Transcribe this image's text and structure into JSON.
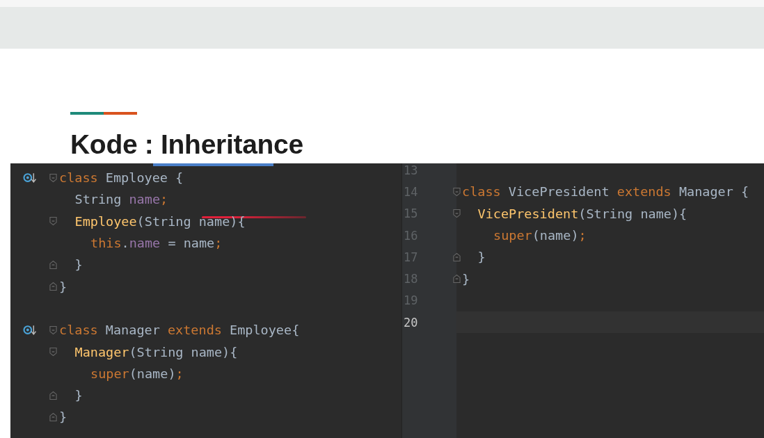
{
  "slide": {
    "title": "Kode : Inheritance"
  },
  "left_editor": {
    "lines": [
      {
        "gutter_icon": true,
        "fold_start": true,
        "fold_end": false,
        "kind": "top",
        "tokens": [
          {
            "kind": "keyword",
            "text": "class "
          },
          {
            "kind": "plain",
            "text": "Employee {"
          }
        ]
      },
      {
        "gutter_icon": false,
        "fold_start": false,
        "fold_end": false,
        "kind": "member",
        "tokens": [
          {
            "kind": "plain",
            "text": "String "
          },
          {
            "kind": "field",
            "text": "name"
          },
          {
            "kind": "keyword",
            "text": ";"
          }
        ]
      },
      {
        "gutter_icon": false,
        "fold_start": true,
        "fold_end": false,
        "kind": "member",
        "tokens": [
          {
            "kind": "method",
            "text": "Employee"
          },
          {
            "kind": "plain",
            "text": "(String name){"
          }
        ]
      },
      {
        "gutter_icon": false,
        "fold_start": false,
        "fold_end": false,
        "kind": "statement",
        "tokens": [
          {
            "kind": "keyword",
            "text": "this"
          },
          {
            "kind": "plain",
            "text": "."
          },
          {
            "kind": "field",
            "text": "name"
          },
          {
            "kind": "plain",
            "text": " = name"
          },
          {
            "kind": "keyword",
            "text": ";"
          }
        ]
      },
      {
        "gutter_icon": false,
        "fold_start": false,
        "fold_end": true,
        "kind": "member",
        "tokens": [
          {
            "kind": "plain",
            "text": "}"
          }
        ]
      },
      {
        "gutter_icon": false,
        "fold_start": false,
        "fold_end": true,
        "kind": "top",
        "tokens": [
          {
            "kind": "plain",
            "text": "}"
          }
        ]
      },
      {
        "gutter_icon": false,
        "fold_start": false,
        "fold_end": false
      },
      {
        "gutter_icon": true,
        "fold_start": true,
        "fold_end": false,
        "kind": "top",
        "tokens": [
          {
            "kind": "keyword",
            "text": "class "
          },
          {
            "kind": "plain",
            "text": "Manager "
          },
          {
            "kind": "keyword",
            "text": "extends "
          },
          {
            "kind": "plain",
            "text": "Employee{"
          }
        ]
      },
      {
        "gutter_icon": false,
        "fold_start": true,
        "fold_end": false,
        "kind": "member",
        "tokens": [
          {
            "kind": "method",
            "text": "Manager"
          },
          {
            "kind": "plain",
            "text": "(String name){"
          }
        ]
      },
      {
        "gutter_icon": false,
        "fold_start": false,
        "fold_end": false,
        "kind": "statement",
        "tokens": [
          {
            "kind": "keyword",
            "text": "super"
          },
          {
            "kind": "plain",
            "text": "(name)"
          },
          {
            "kind": "keyword",
            "text": ";"
          }
        ]
      },
      {
        "gutter_icon": false,
        "fold_start": false,
        "fold_end": true,
        "kind": "member",
        "tokens": [
          {
            "kind": "plain",
            "text": "}"
          }
        ]
      },
      {
        "gutter_icon": false,
        "fold_start": false,
        "fold_end": true,
        "kind": "top",
        "tokens": [
          {
            "kind": "plain",
            "text": "}"
          }
        ]
      }
    ]
  },
  "right_editor": {
    "lines": [
      {
        "number": "13",
        "current": false,
        "fold_start": false,
        "fold_end": false
      },
      {
        "number": "14",
        "current": false,
        "fold_start": true,
        "fold_end": false,
        "kind": "top",
        "tokens": [
          {
            "kind": "keyword",
            "text": "class "
          },
          {
            "kind": "plain",
            "text": "VicePresident "
          },
          {
            "kind": "keyword",
            "text": "extends "
          },
          {
            "kind": "plain",
            "text": "Manager {"
          }
        ]
      },
      {
        "number": "15",
        "current": false,
        "fold_start": true,
        "fold_end": false,
        "kind": "member",
        "tokens": [
          {
            "kind": "method",
            "text": "VicePresident"
          },
          {
            "kind": "plain",
            "text": "(String name){"
          }
        ]
      },
      {
        "number": "16",
        "current": false,
        "fold_start": false,
        "fold_end": false,
        "kind": "statement",
        "tokens": [
          {
            "kind": "keyword",
            "text": "super"
          },
          {
            "kind": "plain",
            "text": "(name)"
          },
          {
            "kind": "keyword",
            "text": ";"
          }
        ]
      },
      {
        "number": "17",
        "current": false,
        "fold_start": false,
        "fold_end": true,
        "kind": "member",
        "tokens": [
          {
            "kind": "plain",
            "text": "}"
          }
        ]
      },
      {
        "number": "18",
        "current": false,
        "fold_start": false,
        "fold_end": true,
        "kind": "top",
        "tokens": [
          {
            "kind": "plain",
            "text": "}"
          }
        ]
      },
      {
        "number": "19",
        "current": false,
        "fold_start": false,
        "fold_end": false
      },
      {
        "number": "20",
        "current": true,
        "fold_start": false,
        "fold_end": false
      }
    ]
  }
}
